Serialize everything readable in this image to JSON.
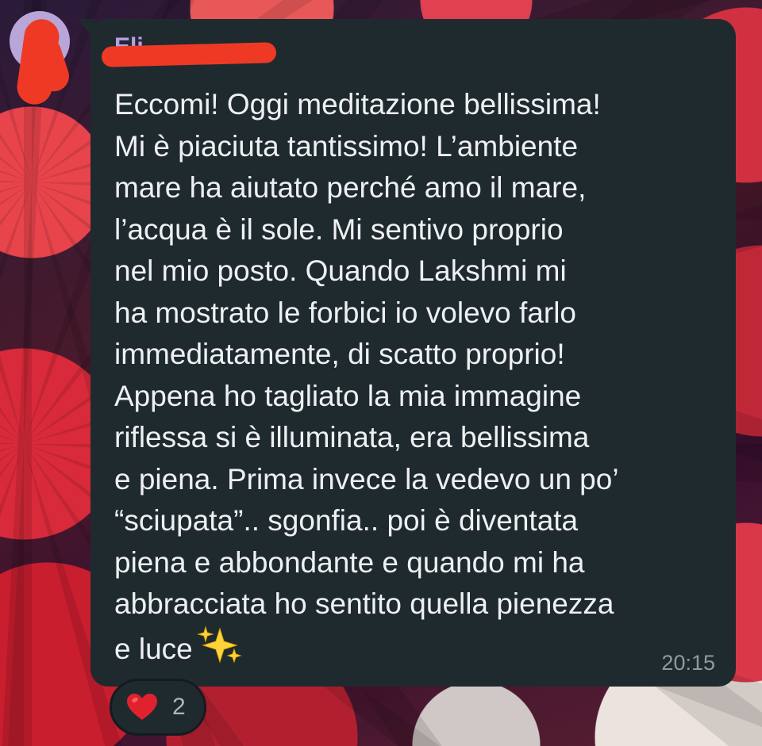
{
  "chat": {
    "sender_name": "Eli",
    "message_text": "Eccomi! Oggi meditazione bellissima!\nMi è piaciuta tantissimo! L’ambiente\nmare ha aiutato perché amo il mare,\nl’acqua è il sole. Mi sentivo proprio\nnel mio posto. Quando Lakshmi mi\nha mostrato le forbici io volevo farlo\nimmediatamente, di scatto proprio!\nAppena ho tagliato la mia immagine\nriflessa si è illuminata, era bellissima\ne piena. Prima invece la vedevo un po’\n“sciupata”.. sgonfia.. poi è diventata\npiena e abbondante e quando mi ha\nabbracciata ho sentito quella pienezza\ne luce",
    "emoji_icon": "sparkles-icon",
    "timestamp": "20:15"
  },
  "reaction": {
    "icon": "heart-icon",
    "count": "2"
  },
  "colors": {
    "bubble": "#1f2a2f",
    "text": "#eef0f1",
    "timestamp": "#8e9aa0",
    "sender": "#b89ee8",
    "redaction": "#ee3a24",
    "heart": "#e0222e"
  }
}
